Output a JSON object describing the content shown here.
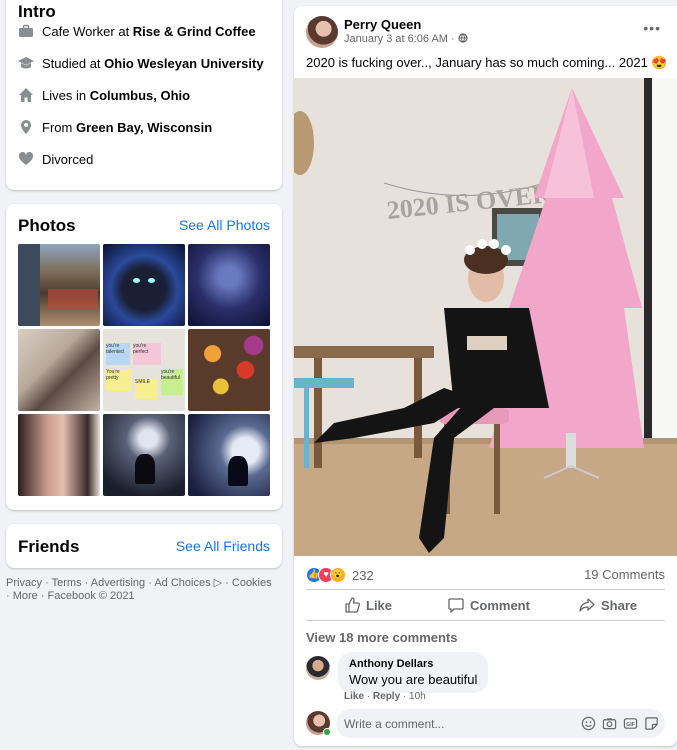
{
  "intro": {
    "title": "Intro",
    "items": [
      {
        "icon": "briefcase-icon",
        "prefix": "Cafe Worker at ",
        "bold": "Rise & Grind Coffee"
      },
      {
        "icon": "graduation-cap-icon",
        "prefix": "Studied at ",
        "bold": "Ohio Wesleyan University"
      },
      {
        "icon": "home-icon",
        "prefix": "Lives in ",
        "bold": "Columbus, Ohio"
      },
      {
        "icon": "location-pin-icon",
        "prefix": "From ",
        "bold": "Green Bay, Wisconsin"
      },
      {
        "icon": "heart-icon",
        "prefix": "Divorced",
        "bold": ""
      }
    ]
  },
  "photos": {
    "title": "Photos",
    "see_all": "See All Photos",
    "notes_text": [
      "you're talented",
      "you're perfect",
      "You're pretty",
      "SMILE",
      "you're beautiful"
    ]
  },
  "friends": {
    "title": "Friends",
    "see_all": "See All Friends"
  },
  "footer": {
    "text": "Privacy · Terms · Advertising · Ad Choices ▷ · Cookies · More · Facebook © 2021"
  },
  "post": {
    "author": "Perry Queen",
    "time": "January 3 at 6:06 AM · ",
    "more": "•••",
    "text": "2020 is fucking over.., January has so much coming... 2021 😍",
    "banner_text": "2020 IS OVER",
    "reaction_count": "232",
    "comments_count": "19 Comments",
    "actions": {
      "like": "Like",
      "comment": "Comment",
      "share": "Share"
    },
    "view_more": "View 18 more comments",
    "comment": {
      "author": "Anthony Dellars",
      "text": "Wow you are beautiful",
      "like": "Like",
      "reply": "Reply",
      "time": "10h"
    },
    "write_placeholder": "Write a comment..."
  },
  "colors": {
    "accent": "#1b74e4",
    "like_blue": "#1877f2",
    "love_red": "#f33e58",
    "wow_yellow": "#f7b125"
  }
}
